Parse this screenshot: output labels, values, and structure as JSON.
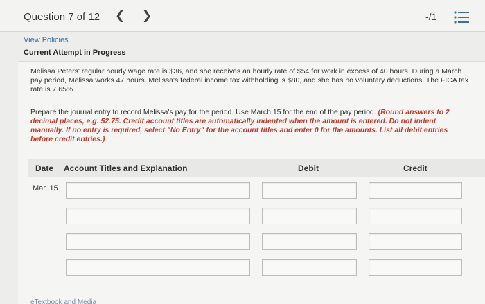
{
  "header": {
    "question": "Question 7 of 12",
    "prev_icon": "chevron-left-icon",
    "next_icon": "chevron-right-icon",
    "score": "-/1",
    "list_icon": "list-icon"
  },
  "links": {
    "view_policies": "View Policies",
    "attempt_status": "Current Attempt in Progress"
  },
  "problem": {
    "text": "Melissa Peters' regular hourly wage rate is $36, and she receives an hourly rate of $54 for work in excess of 40 hours. During a March pay period, Melissa works 47 hours. Melissa's federal income tax withholding is $80, and she has no voluntary deductions. The FICA tax rate is 7.65%.",
    "instruction_plain": "Prepare the journal entry to record Melissa's pay for the period. Use March 15 for the end of the pay period. ",
    "instruction_red": "(Round answers to 2 decimal places, e.g. 52.75. Credit account titles are automatically indented when the amount is entered. Do not indent manually. If no entry is required, select \"No Entry\" for the account titles and enter 0 for the amounts. List all debit entries before credit entries.)"
  },
  "table": {
    "headers": {
      "date": "Date",
      "account": "Account Titles and Explanation",
      "debit": "Debit",
      "credit": "Credit"
    },
    "date_value": "Mar. 15",
    "rows": [
      {
        "account": "",
        "debit": "",
        "credit": ""
      },
      {
        "account": "",
        "debit": "",
        "credit": ""
      },
      {
        "account": "",
        "debit": "",
        "credit": ""
      },
      {
        "account": "",
        "debit": "",
        "credit": ""
      }
    ]
  },
  "footer": {
    "link": "eTextbook and Media"
  }
}
